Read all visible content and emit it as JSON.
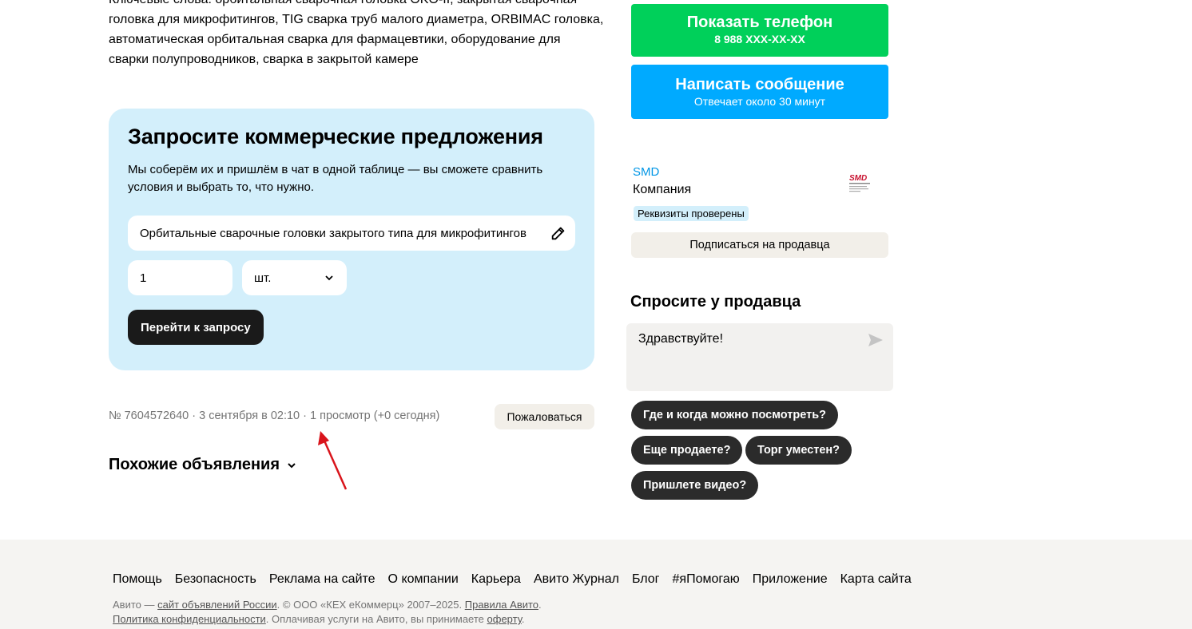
{
  "description": {
    "keywords_text": "Ключевые слова: орбитальная сварочная головка OKO-II, закрытая сварочная головка для микрофитингов, TIG сварка труб малого диаметра, ORBIMAC головка, автоматическая орбитальная сварка для фармацевтики, оборудование для сварки полупроводников, сварка в закрытой камере"
  },
  "request": {
    "title": "Запросите коммерческие предложения",
    "description": "Мы соберём их и пришлём в чат в одной таблице — вы сможете сравнить условия и выбрать то, что нужно.",
    "product_value": "Орбитальные сварочные головки закрытого типа для микрофитингов",
    "quantity_value": "1",
    "unit_value": "шт.",
    "submit_label": "Перейти к запросу"
  },
  "meta": {
    "text": "№ 7604572640 · 3 сентября в 02:10 · 1 просмотр (+0 сегодня)",
    "complain_label": "Пожаловаться"
  },
  "similar": {
    "title": "Похожие объявления"
  },
  "contact": {
    "phone_label": "Показать телефон",
    "phone_masked": "8 988 XXX-XX-XX",
    "message_label": "Написать сообщение",
    "message_sub": "Отвечает около 30 минут"
  },
  "seller": {
    "name": "SMD",
    "type": "Компания",
    "badge": "Реквизиты проверены",
    "logo_text": "SMD",
    "logo_subtext": "SMART MECHANICAL DEVICES",
    "subscribe_label": "Подписаться на продавца"
  },
  "ask": {
    "title": "Спросите у продавца",
    "message_value": "Здравствуйте!",
    "chips": [
      "Где и когда можно посмотреть?",
      "Еще продаете?",
      "Торг уместен?",
      "Пришлете видео?"
    ]
  },
  "footer": {
    "links": [
      "Помощь",
      "Безопасность",
      "Реклама на сайте",
      "О компании",
      "Карьера",
      "Авито Журнал",
      "Блог",
      "#яПомогаю",
      "Приложение",
      "Карта сайта"
    ],
    "legal_prefix": "Авито — ",
    "legal_link1": "сайт объявлений России",
    "legal_mid": ". © ООО «КЕХ еКоммерц» 2007–2025. ",
    "legal_link2": "Правила Авито",
    "legal_end1": ".",
    "legal_link3": "Политика конфиденциальности",
    "legal_mid2": ". Оплачивая услуги на Авито, вы принимаете ",
    "legal_link4": "оферту",
    "legal_end2": "."
  },
  "colors": {
    "phone_green": "#00d05a",
    "message_blue": "#00aaff",
    "request_bg": "#d3effb",
    "annotation_red": "#d9141b"
  }
}
